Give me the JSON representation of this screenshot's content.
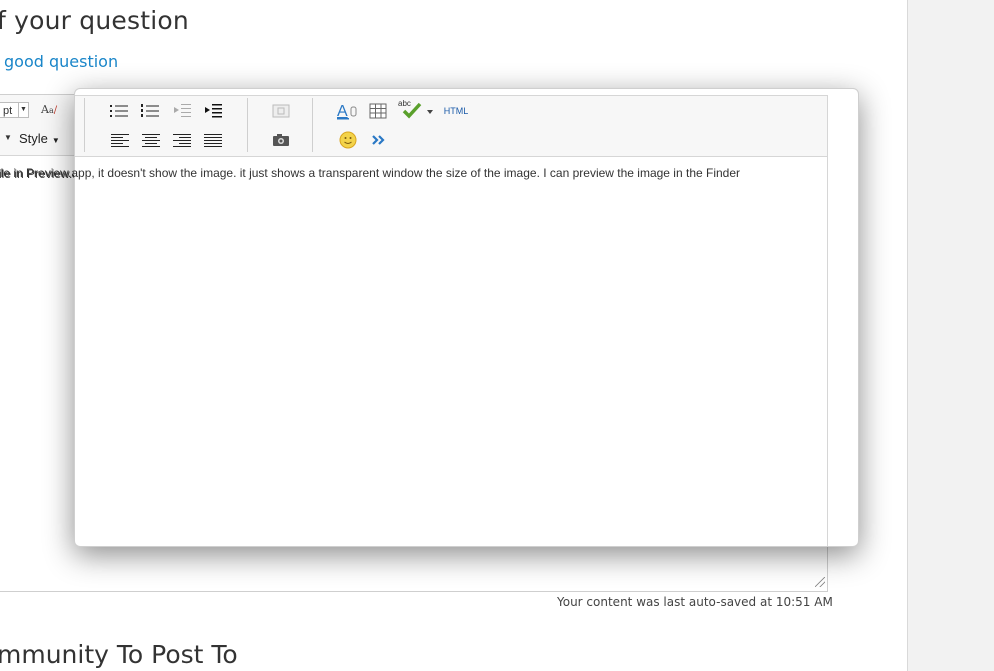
{
  "page": {
    "heading_top": "f your question",
    "link_good_question": "good question",
    "heading_bottom": "mmunity To Post To",
    "autosave_text": "Your content was last auto-saved at 10:51 AM"
  },
  "bg_editor": {
    "font_size_value": "pt",
    "style_label": "Style",
    "body_text": "ile in Preview.app, it doesn't show the image."
  },
  "popup_editor": {
    "html_button": "HTML",
    "body_text": "ile in Preview.app, it doesn't show the image.  it just shows a transparent window the size of the image.  I can preview the image in the Finder",
    "toolbar_icons": [
      "bullet-list-icon",
      "numbered-list-icon",
      "outdent-icon",
      "indent-icon",
      "align-left-icon",
      "align-center-icon",
      "align-right-icon",
      "align-justify-icon",
      "insert-image-icon",
      "insert-photo-icon",
      "text-color-icon",
      "table-icon",
      "spellcheck-icon",
      "html-button",
      "emoticon-icon",
      "more-options-icon"
    ]
  },
  "colors": {
    "link": "#1a86c9",
    "accent_blue": "#2a78c5",
    "rail": "#f2f2f2"
  }
}
